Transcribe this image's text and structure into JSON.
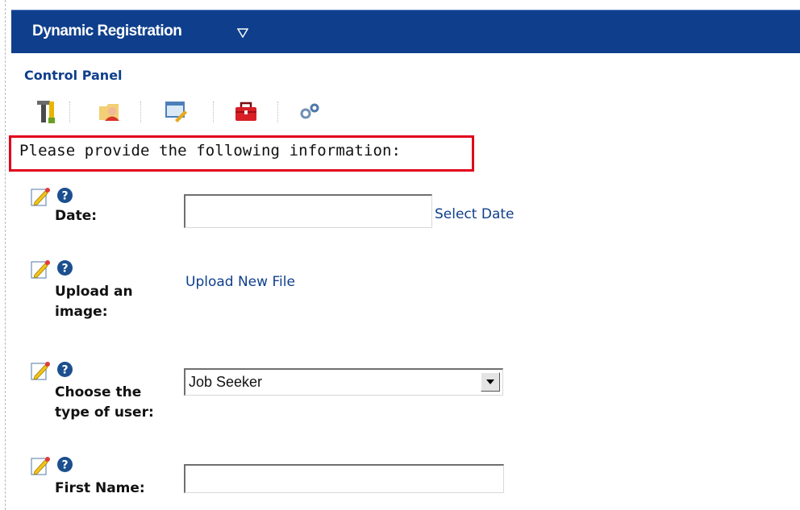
{
  "header": {
    "title": "Dynamic Registration"
  },
  "control_panel": {
    "title": "Control Panel",
    "tools": [
      "tools-icon",
      "user-folder-icon",
      "edit-window-icon",
      "toolbox-icon",
      "gears-icon"
    ]
  },
  "form": {
    "instructions": "Please provide the following information:",
    "fields": {
      "date": {
        "label": "Date:",
        "value": "",
        "link": "Select Date"
      },
      "image": {
        "label": "Upload an image:",
        "link": "Upload New File"
      },
      "user_type": {
        "label": "Choose the type of user:",
        "selected": "Job Seeker"
      },
      "first_name": {
        "label": "First Name:",
        "value": ""
      }
    }
  },
  "colors": {
    "header_bg": "#0f3f8c",
    "accent_link": "#0f3f8c",
    "highlight_border": "#e0001b"
  }
}
